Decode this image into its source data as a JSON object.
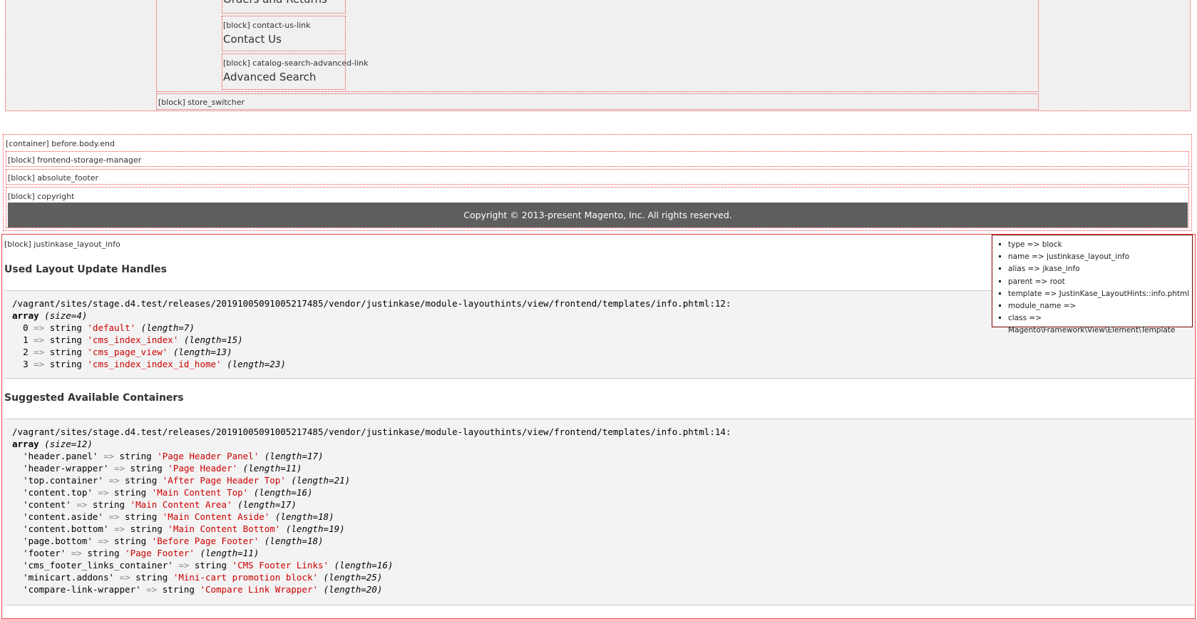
{
  "nav_links": [
    {
      "hint": "",
      "label": "Orders and Returns"
    },
    {
      "hint": "[block] contact-us-link",
      "label": "Contact Us"
    },
    {
      "hint": "[block] catalog-search-advanced-link",
      "label": "Advanced Search"
    }
  ],
  "store_switcher": "[block] store_switcher",
  "before_body_end": "[container] before.body.end",
  "frontend_storage": "[block] frontend-storage-manager",
  "absolute_footer": "[block] absolute_footer",
  "copyright_hint": "[block] copyright",
  "copyright_text": "Copyright © 2013-present Magento, Inc. All rights reserved.",
  "layout_info_hint": "[block] justinkase_layout_info",
  "info_panel": [
    "type => block",
    "name => justinkase_layout_info",
    "alias => jkase_info",
    "parent => root",
    "template => JustinKase_LayoutHints::info.phtml",
    "module_name =>",
    "class => Magento\\Framework\\View\\Element\\Template"
  ],
  "handles": {
    "heading": "Used Layout Update Handles",
    "path": "/vagrant/sites/stage.d4.test/releases/20191005091005217485/vendor/justinkase/module-layouthints/view/frontend/templates/info.phtml:12:",
    "array_kw": "array",
    "array_size": "(size=4)",
    "items": [
      {
        "key": "0",
        "value": "'default'",
        "len": "(length=7)"
      },
      {
        "key": "1",
        "value": "'cms_index_index'",
        "len": "(length=15)"
      },
      {
        "key": "2",
        "value": "'cms_page_view'",
        "len": "(length=13)"
      },
      {
        "key": "3",
        "value": "'cms_index_index_id_home'",
        "len": "(length=23)"
      }
    ]
  },
  "containers": {
    "heading": "Suggested Available Containers",
    "path": "/vagrant/sites/stage.d4.test/releases/20191005091005217485/vendor/justinkase/module-layouthints/view/frontend/templates/info.phtml:14:",
    "array_kw": "array",
    "array_size": "(size=12)",
    "items": [
      {
        "key": "'header.panel'",
        "value": "'Page Header Panel'",
        "len": "(length=17)"
      },
      {
        "key": "'header-wrapper'",
        "value": "'Page Header'",
        "len": "(length=11)"
      },
      {
        "key": "'top.container'",
        "value": "'After Page Header Top'",
        "len": "(length=21)"
      },
      {
        "key": "'content.top'",
        "value": "'Main Content Top'",
        "len": "(length=16)"
      },
      {
        "key": "'content'",
        "value": "'Main Content Area'",
        "len": "(length=17)"
      },
      {
        "key": "'content.aside'",
        "value": "'Main Content Aside'",
        "len": "(length=18)"
      },
      {
        "key": "'content.bottom'",
        "value": "'Main Content Bottom'",
        "len": "(length=19)"
      },
      {
        "key": "'page.bottom'",
        "value": "'Before Page Footer'",
        "len": "(length=18)"
      },
      {
        "key": "'footer'",
        "value": "'Page Footer'",
        "len": "(length=11)"
      },
      {
        "key": "'cms_footer_links_container'",
        "value": "'CMS Footer Links'",
        "len": "(length=16)"
      },
      {
        "key": "'minicart.addons'",
        "value": "'Mini-cart promotion block'",
        "len": "(length=25)"
      },
      {
        "key": "'compare-link-wrapper'",
        "value": "'Compare Link Wrapper'",
        "len": "(length=20)"
      }
    ]
  },
  "tokens": {
    "arrow": "=>",
    "string_kw": "string"
  }
}
